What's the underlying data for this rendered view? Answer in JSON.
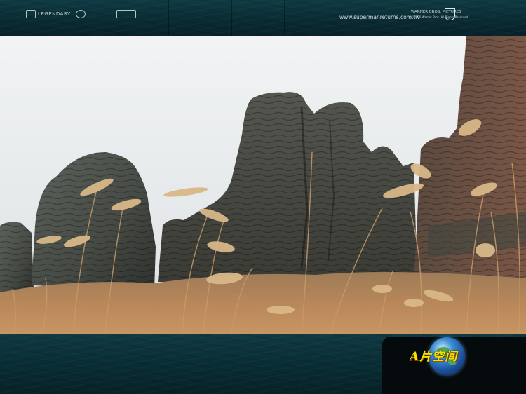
{
  "header": {
    "logo_left": "LEGENDARY",
    "website": "www.supermanreturns.com.tw",
    "studio": "WARNER BROS. PICTURES",
    "studio_sub": "©2006 Warner Bros. All Rights Reserved"
  },
  "photo": {
    "subject": "rock-formation-with-grass",
    "colors": {
      "sky": "#e4e8ea",
      "rock": "#4a4f4a",
      "grass": "#b9895a"
    }
  },
  "footer": {
    "brand_text": "A片空间",
    "brand_color": "#f2e600",
    "icon": "globe-icon"
  }
}
